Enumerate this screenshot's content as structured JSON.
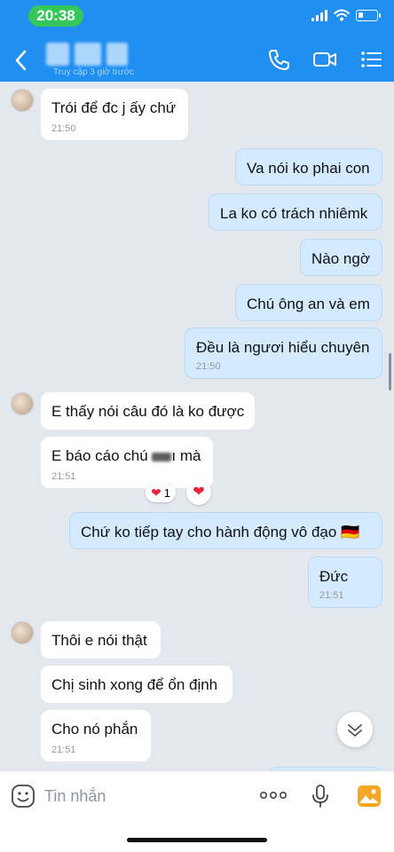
{
  "status": {
    "time": "20:38"
  },
  "header": {
    "subtitle": "Truy cập 3 giờ trước"
  },
  "messages": {
    "m1": {
      "text": "Trói để đc j ấy chứ",
      "time": "21:50"
    },
    "m2": {
      "text": "Va nói ko phai con"
    },
    "m3": {
      "text": "La ko có trách nhiêmk"
    },
    "m4": {
      "text": "Nào ngờ"
    },
    "m5": {
      "text": "Chú ông an và em"
    },
    "m6": {
      "text": "Đều là ngươi hiểu chuyên",
      "time": "21:50"
    },
    "m7": {
      "text": "E thấy nói câu đó là ko được"
    },
    "m8": {
      "text_before": "E báo cáo chú ",
      "text_after": "ı mà",
      "time": "21:51",
      "reaction_count": "1"
    },
    "m9": {
      "text": "Chứ ko tiếp tay cho hành động vô đạo 🇩🇪"
    },
    "m10": {
      "text": "Đức",
      "time": "21:51"
    },
    "m11": {
      "text": "Thôi e nói thật"
    },
    "m12": {
      "text": "Chị sinh xong để ổn định"
    },
    "m13": {
      "text": "Cho nó phắn",
      "time": "21:51"
    }
  },
  "input": {
    "placeholder": "Tin nhắn"
  },
  "colors": {
    "header": "#1f8ff2",
    "outgoing": "#d4eafe",
    "incoming": "#ffffff",
    "background": "#e3e8ee",
    "heart": "#e8253a"
  },
  "icons": [
    "back-icon",
    "phone-icon",
    "video-call-icon",
    "menu-icon",
    "emoji-icon",
    "more-icon",
    "microphone-icon",
    "image-icon",
    "chevron-down-icon",
    "heart-icon"
  ]
}
